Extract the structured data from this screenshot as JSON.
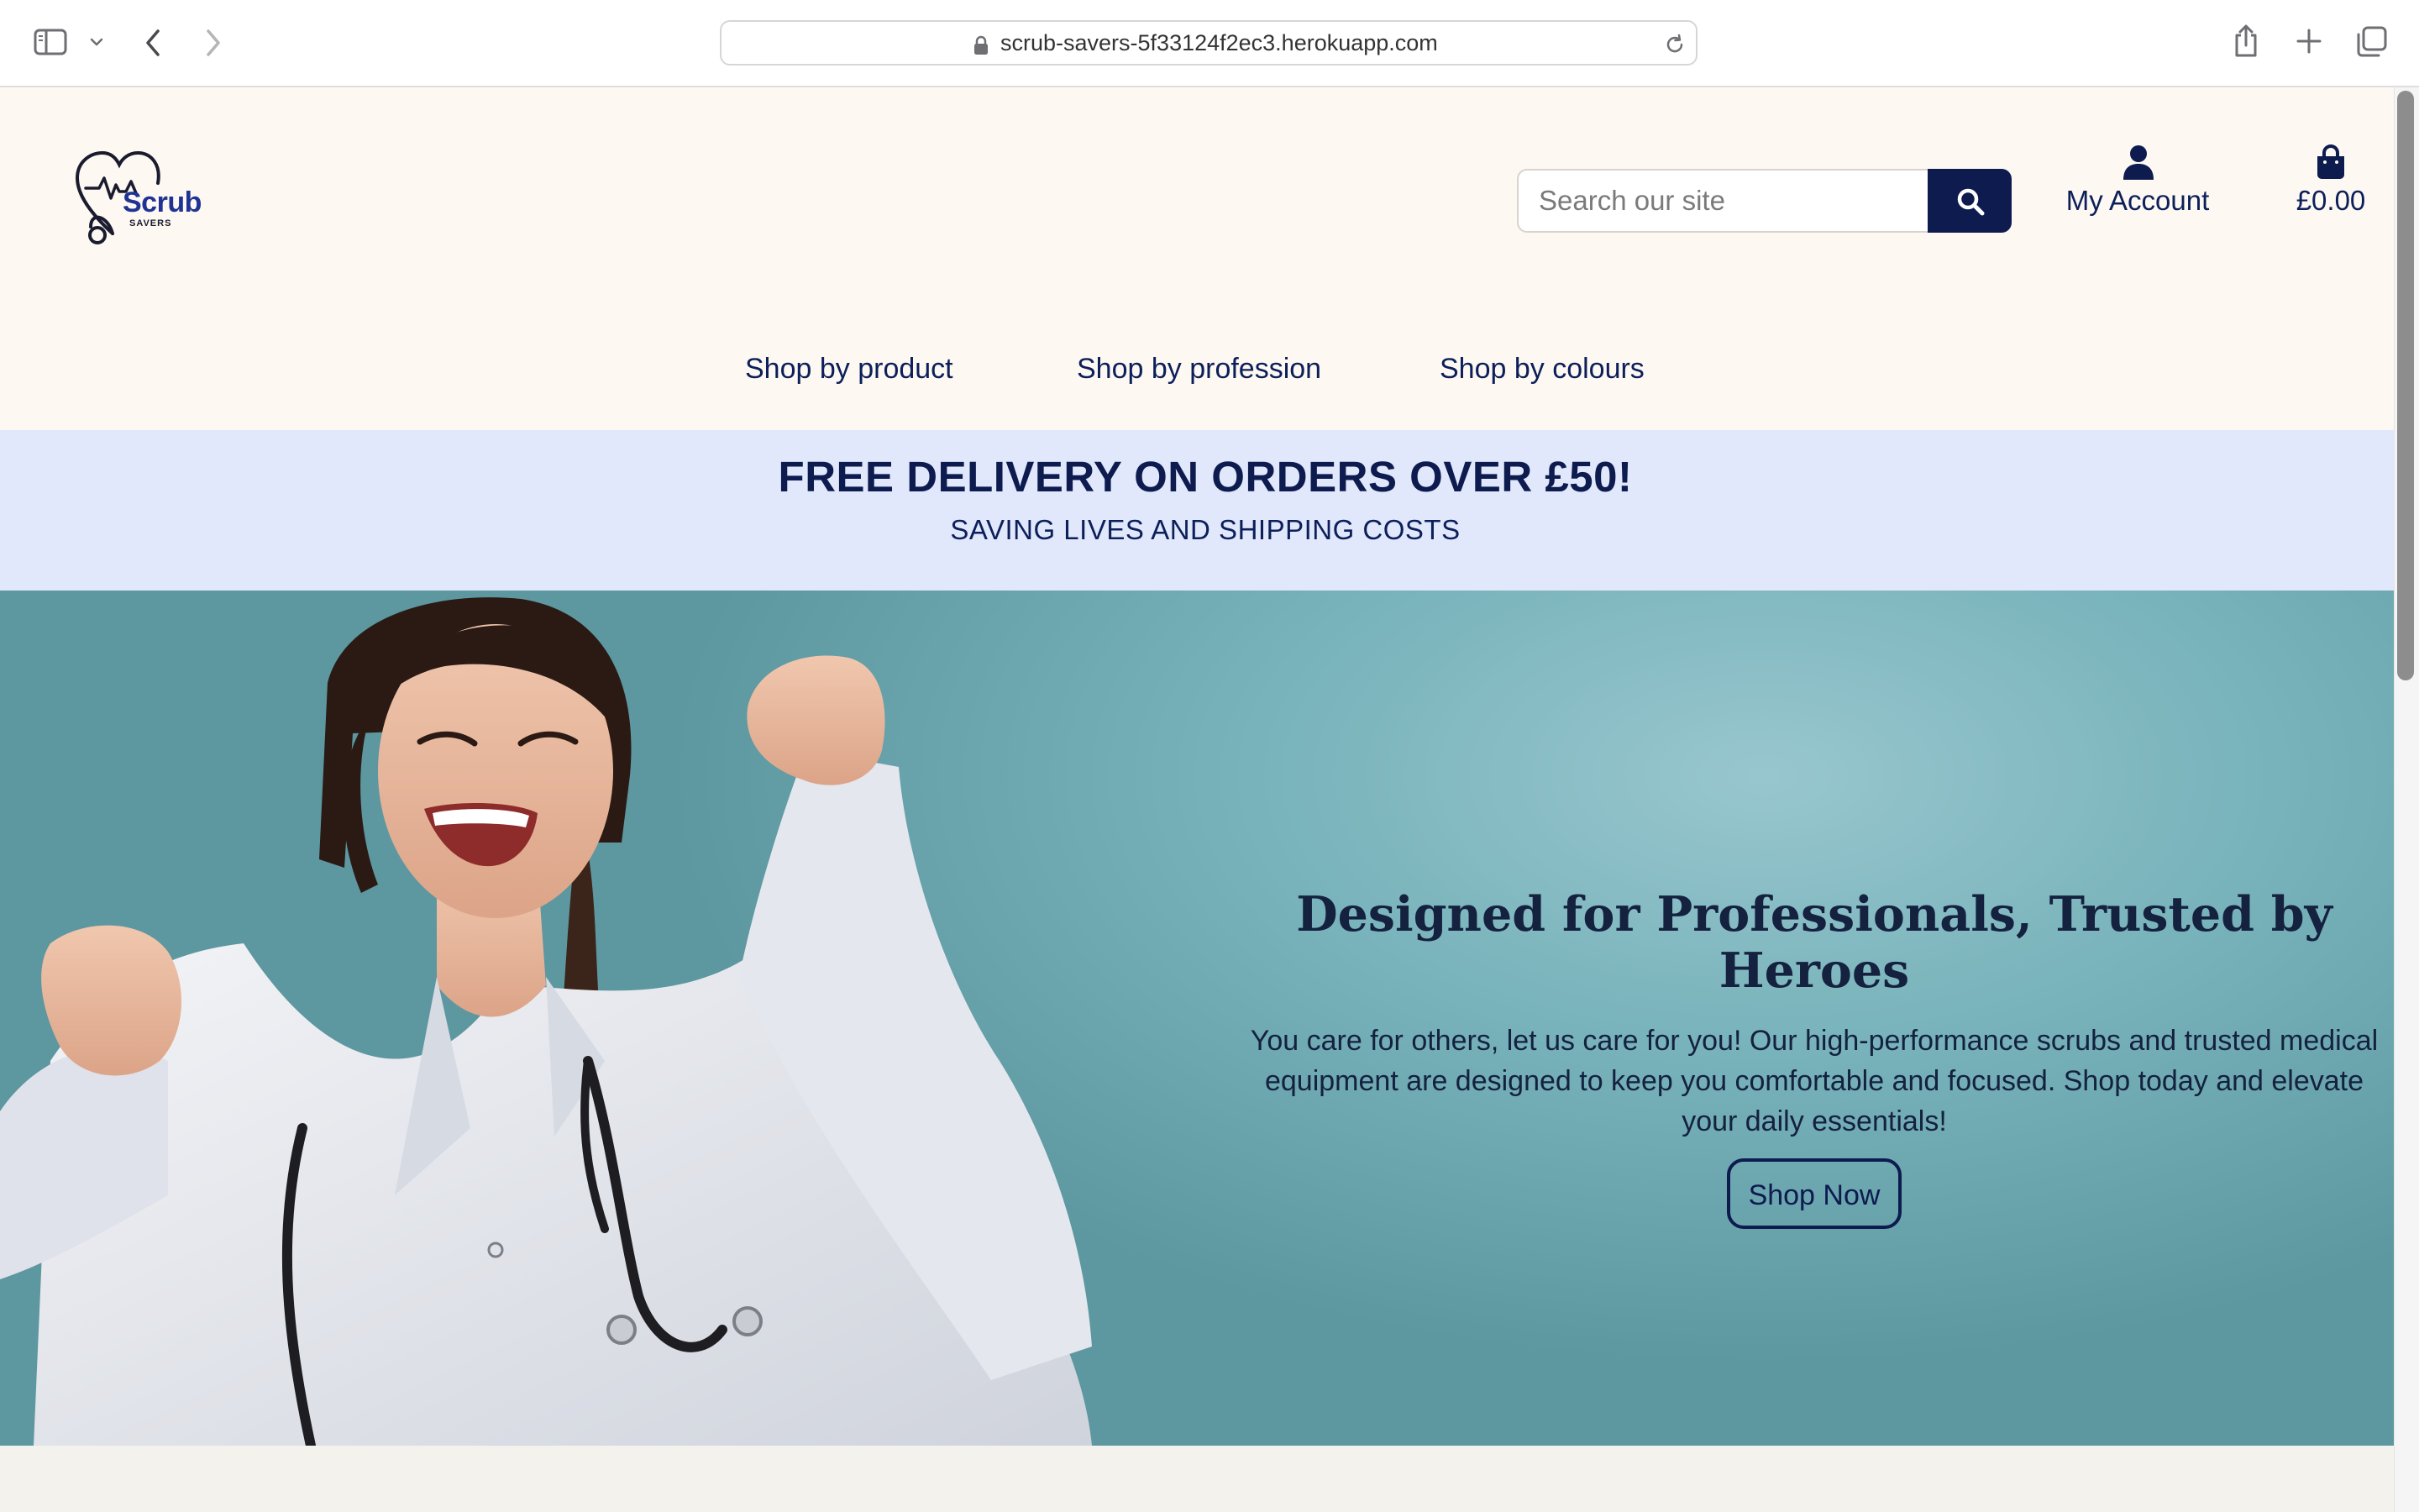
{
  "browser": {
    "url": "scrub-savers-5f33124f2ec3.herokuapp.com",
    "icons": [
      "sidebar-icon",
      "chevron-down-icon",
      "back-arrow-icon",
      "forward-arrow-icon",
      "lock-icon",
      "reload-icon",
      "share-icon",
      "new-tab-icon",
      "tabs-overview-icon"
    ]
  },
  "header": {
    "logo": {
      "word1": "Scrub",
      "word2": "SAVERS"
    },
    "search": {
      "placeholder": "Search our site",
      "value": ""
    },
    "account_label": "My Account",
    "basket_total": "£0.00"
  },
  "nav": {
    "items": [
      {
        "label": "Shop by product"
      },
      {
        "label": "Shop by profession"
      },
      {
        "label": "Shop by colours"
      }
    ]
  },
  "promo": {
    "title": "FREE DELIVERY ON ORDERS OVER £50!",
    "subtitle": "SAVING LIVES AND SHIPPING COSTS"
  },
  "hero": {
    "title": "Designed for Professionals, Trusted by Heroes",
    "body": "You care for others, let us care for you! Our high-performance scrubs and trusted medical equipment are designed to keep you comfortable and focused. Shop today and elevate your daily essentials!",
    "cta": "Shop Now"
  },
  "colors": {
    "navy": "#0d1b4f",
    "header_bg": "#fdf8f1",
    "promo_bg": "#e1e8fb",
    "hero_bg": "#7ab3bb"
  }
}
